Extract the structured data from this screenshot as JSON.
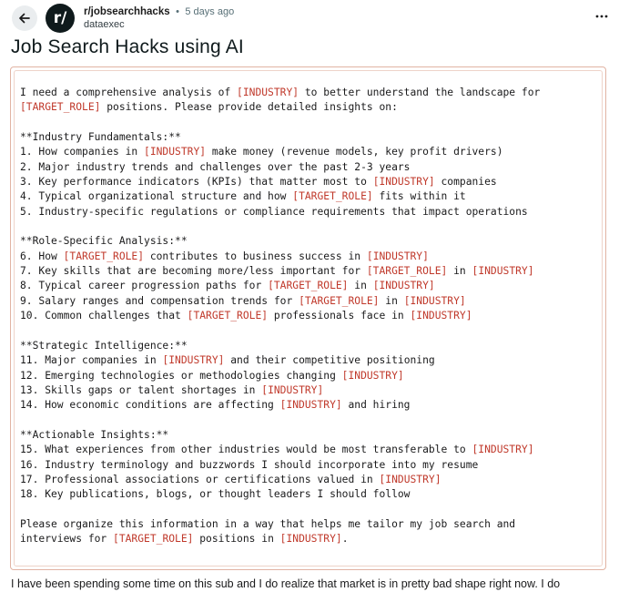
{
  "header": {
    "subreddit": "r/jobsearchhacks",
    "separator": "•",
    "age": "5 days ago",
    "author": "dataexec",
    "subreddit_icon_text": "r/",
    "back_icon": "back-arrow-icon",
    "more_icon": "more-options-icon"
  },
  "post": {
    "title": "Job Search Hacks using AI",
    "prompt_lines": [
      "I need a comprehensive analysis of [INDUSTRY] to better understand the landscape for",
      "[TARGET_ROLE] positions. Please provide detailed insights on:",
      "",
      "**Industry Fundamentals:**",
      "1. How companies in [INDUSTRY] make money (revenue models, key profit drivers)",
      "2. Major industry trends and challenges over the past 2-3 years",
      "3. Key performance indicators (KPIs) that matter most to [INDUSTRY] companies",
      "4. Typical organizational structure and how [TARGET_ROLE] fits within it",
      "5. Industry-specific regulations or compliance requirements that impact operations",
      "",
      "**Role-Specific Analysis:**",
      "6. How [TARGET_ROLE] contributes to business success in [INDUSTRY]",
      "7. Key skills that are becoming more/less important for [TARGET_ROLE] in [INDUSTRY]",
      "8. Typical career progression paths for [TARGET_ROLE] in [INDUSTRY]",
      "9. Salary ranges and compensation trends for [TARGET_ROLE] in [INDUSTRY]",
      "10. Common challenges that [TARGET_ROLE] professionals face in [INDUSTRY]",
      "",
      "**Strategic Intelligence:**",
      "11. Major companies in [INDUSTRY] and their competitive positioning",
      "12. Emerging technologies or methodologies changing [INDUSTRY]",
      "13. Skills gaps or talent shortages in [INDUSTRY]",
      "14. How economic conditions are affecting [INDUSTRY] and hiring",
      "",
      "**Actionable Insights:**",
      "15. What experiences from other industries would be most transferable to [INDUSTRY]",
      "16. Industry terminology and buzzwords I should incorporate into my resume",
      "17. Professional associations or certifications valued in [INDUSTRY]",
      "18. Key publications, blogs, or thought leaders I should follow",
      "",
      "Please organize this information in a way that helps me tailor my job search and",
      "interviews for [TARGET_ROLE] positions in [INDUSTRY]."
    ],
    "body_preview": "I have been spending some time on this sub and I do realize that market is in pretty bad shape right now. I do"
  },
  "colors": {
    "placeholder": "#c0392b",
    "box_border": "#e1b3a3",
    "muted_text": "#576f76"
  }
}
